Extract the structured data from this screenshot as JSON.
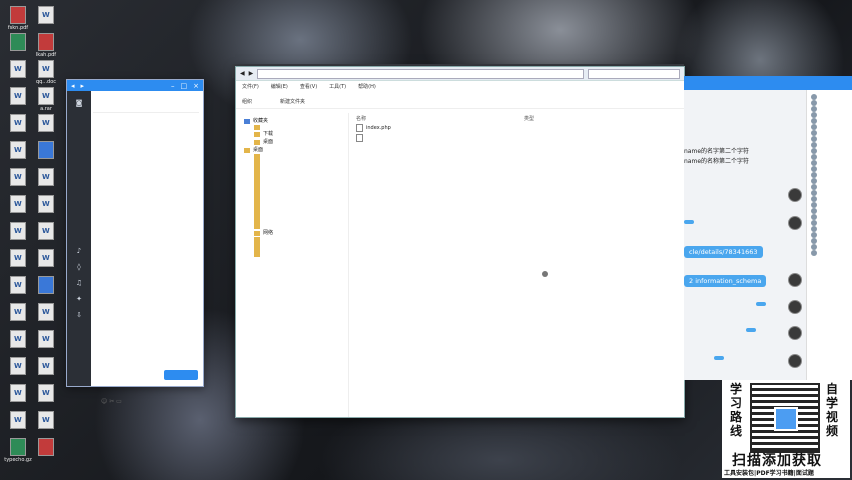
{
  "desktop": {
    "icons": [
      {
        "label": "fskn.pdf",
        "type": "red"
      },
      {
        "label": "",
        "type": "word"
      },
      {
        "label": "",
        "type": "green"
      },
      {
        "label": "lkah.pdf",
        "type": "red"
      },
      {
        "label": "",
        "type": "word"
      },
      {
        "label": "qq...doc",
        "type": "word"
      },
      {
        "label": "",
        "type": "word"
      },
      {
        "label": "a.rar",
        "type": "word"
      },
      {
        "label": "",
        "type": "word"
      },
      {
        "label": "",
        "type": "word"
      },
      {
        "label": "",
        "type": "word"
      },
      {
        "label": "",
        "type": "blue"
      },
      {
        "label": "",
        "type": "word"
      },
      {
        "label": "",
        "type": "word"
      },
      {
        "label": "",
        "type": "word"
      },
      {
        "label": "",
        "type": "word"
      },
      {
        "label": "",
        "type": "word"
      },
      {
        "label": "",
        "type": "word"
      },
      {
        "label": "",
        "type": "word"
      },
      {
        "label": "",
        "type": "word"
      },
      {
        "label": "",
        "type": "word"
      },
      {
        "label": "",
        "type": "blue"
      },
      {
        "label": "",
        "type": "word"
      },
      {
        "label": "",
        "type": "word"
      },
      {
        "label": "",
        "type": "word"
      },
      {
        "label": "",
        "type": "word"
      },
      {
        "label": "",
        "type": "word"
      },
      {
        "label": "",
        "type": "word"
      },
      {
        "label": "",
        "type": "word"
      },
      {
        "label": "",
        "type": "word"
      },
      {
        "label": "",
        "type": "word"
      },
      {
        "label": "",
        "type": "word"
      },
      {
        "label": "typecho.gz",
        "type": "green"
      },
      {
        "label": "",
        "type": "red"
      }
    ]
  },
  "tray": {
    "items": [
      "",
      "",
      ""
    ]
  },
  "chat_app": {
    "tab_left": "",
    "tab_right": "",
    "send_label": ""
  },
  "explorer": {
    "address": "",
    "menu": [
      "文件(F)",
      "编辑(E)",
      "查看(V)",
      "工具(T)",
      "帮助(H)"
    ],
    "toolbar": [
      "组织",
      "",
      "新建文件夹"
    ],
    "nav": [
      {
        "label": "收藏夹",
        "icon": "star"
      },
      {
        "label": "",
        "icon": "folder"
      },
      {
        "label": "下载",
        "icon": "folder"
      },
      {
        "label": "桌面",
        "icon": "folder"
      },
      {
        "label": "",
        "icon": "spacer"
      },
      {
        "label": "桌面",
        "icon": "folder"
      },
      {
        "label": "",
        "icon": "folder"
      },
      {
        "label": "",
        "icon": "folder"
      },
      {
        "label": "",
        "icon": "folder"
      },
      {
        "label": "",
        "icon": "folder"
      },
      {
        "label": "",
        "icon": "folder"
      },
      {
        "label": "",
        "icon": "folder"
      },
      {
        "label": "",
        "icon": "folder"
      },
      {
        "label": "",
        "icon": "folder"
      },
      {
        "label": "",
        "icon": "folder"
      },
      {
        "label": "",
        "icon": "folder"
      },
      {
        "label": "",
        "icon": "folder"
      },
      {
        "label": "",
        "icon": "folder"
      },
      {
        "label": "",
        "icon": "folder"
      },
      {
        "label": "",
        "icon": "folder"
      },
      {
        "label": "",
        "icon": "folder"
      },
      {
        "label": "网络",
        "icon": "folder"
      },
      {
        "label": "",
        "icon": "folder"
      },
      {
        "label": "",
        "icon": "folder"
      },
      {
        "label": "",
        "icon": "folder"
      },
      {
        "label": "",
        "icon": "folder"
      }
    ],
    "columns": [
      "名称",
      "",
      "类型",
      ""
    ],
    "files": [
      {
        "name": "index.php",
        "date": "",
        "type": "",
        "size": ""
      },
      {
        "name": "",
        "date": "",
        "type": "",
        "size": ""
      }
    ],
    "status": ""
  },
  "right_chat": {
    "header": "",
    "texts": [
      {
        "text": "name的名字第二个字符"
      },
      {
        "text": "name的名称第二个字符"
      }
    ],
    "bubbles": [
      {
        "text": ""
      },
      {
        "text": "cle/details/78341663"
      },
      {
        "text": "2 information_schema"
      },
      {
        "text": ""
      },
      {
        "text": ""
      },
      {
        "text": ""
      }
    ],
    "members_title": "",
    "members": [
      "",
      "",
      "",
      "",
      "",
      "",
      "",
      "",
      "",
      "",
      "",
      "",
      "",
      "",
      "",
      "",
      "",
      "",
      "",
      "",
      "",
      "",
      "",
      "",
      "",
      "",
      ""
    ]
  },
  "ad": {
    "left_chars": "学习路线",
    "right_chars": "自学视频",
    "scan": "扫描添加获取",
    "sub": "工具安装包|PDF学习书籍|面试题"
  }
}
